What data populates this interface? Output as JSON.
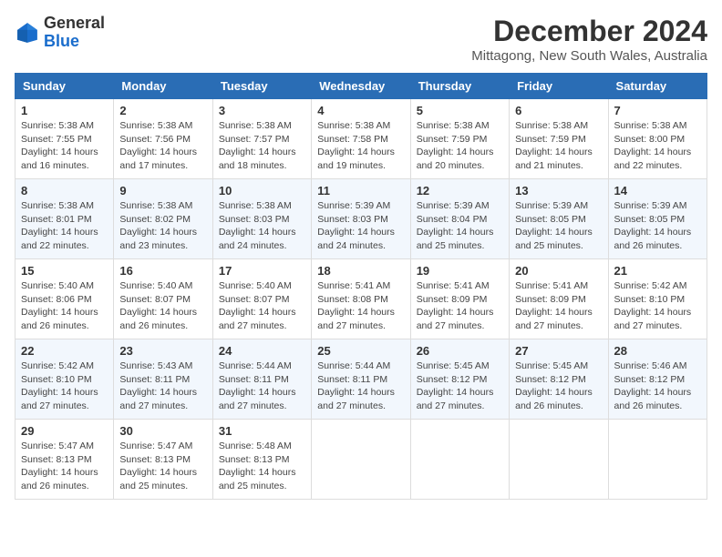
{
  "logo": {
    "general": "General",
    "blue": "Blue"
  },
  "header": {
    "month_title": "December 2024",
    "location": "Mittagong, New South Wales, Australia"
  },
  "days_of_week": [
    "Sunday",
    "Monday",
    "Tuesday",
    "Wednesday",
    "Thursday",
    "Friday",
    "Saturday"
  ],
  "weeks": [
    [
      {
        "day": "1",
        "sunrise": "5:38 AM",
        "sunset": "7:55 PM",
        "daylight": "14 hours and 16 minutes."
      },
      {
        "day": "2",
        "sunrise": "5:38 AM",
        "sunset": "7:56 PM",
        "daylight": "14 hours and 17 minutes."
      },
      {
        "day": "3",
        "sunrise": "5:38 AM",
        "sunset": "7:57 PM",
        "daylight": "14 hours and 18 minutes."
      },
      {
        "day": "4",
        "sunrise": "5:38 AM",
        "sunset": "7:58 PM",
        "daylight": "14 hours and 19 minutes."
      },
      {
        "day": "5",
        "sunrise": "5:38 AM",
        "sunset": "7:59 PM",
        "daylight": "14 hours and 20 minutes."
      },
      {
        "day": "6",
        "sunrise": "5:38 AM",
        "sunset": "7:59 PM",
        "daylight": "14 hours and 21 minutes."
      },
      {
        "day": "7",
        "sunrise": "5:38 AM",
        "sunset": "8:00 PM",
        "daylight": "14 hours and 22 minutes."
      }
    ],
    [
      {
        "day": "8",
        "sunrise": "5:38 AM",
        "sunset": "8:01 PM",
        "daylight": "14 hours and 22 minutes."
      },
      {
        "day": "9",
        "sunrise": "5:38 AM",
        "sunset": "8:02 PM",
        "daylight": "14 hours and 23 minutes."
      },
      {
        "day": "10",
        "sunrise": "5:38 AM",
        "sunset": "8:03 PM",
        "daylight": "14 hours and 24 minutes."
      },
      {
        "day": "11",
        "sunrise": "5:39 AM",
        "sunset": "8:03 PM",
        "daylight": "14 hours and 24 minutes."
      },
      {
        "day": "12",
        "sunrise": "5:39 AM",
        "sunset": "8:04 PM",
        "daylight": "14 hours and 25 minutes."
      },
      {
        "day": "13",
        "sunrise": "5:39 AM",
        "sunset": "8:05 PM",
        "daylight": "14 hours and 25 minutes."
      },
      {
        "day": "14",
        "sunrise": "5:39 AM",
        "sunset": "8:05 PM",
        "daylight": "14 hours and 26 minutes."
      }
    ],
    [
      {
        "day": "15",
        "sunrise": "5:40 AM",
        "sunset": "8:06 PM",
        "daylight": "14 hours and 26 minutes."
      },
      {
        "day": "16",
        "sunrise": "5:40 AM",
        "sunset": "8:07 PM",
        "daylight": "14 hours and 26 minutes."
      },
      {
        "day": "17",
        "sunrise": "5:40 AM",
        "sunset": "8:07 PM",
        "daylight": "14 hours and 27 minutes."
      },
      {
        "day": "18",
        "sunrise": "5:41 AM",
        "sunset": "8:08 PM",
        "daylight": "14 hours and 27 minutes."
      },
      {
        "day": "19",
        "sunrise": "5:41 AM",
        "sunset": "8:09 PM",
        "daylight": "14 hours and 27 minutes."
      },
      {
        "day": "20",
        "sunrise": "5:41 AM",
        "sunset": "8:09 PM",
        "daylight": "14 hours and 27 minutes."
      },
      {
        "day": "21",
        "sunrise": "5:42 AM",
        "sunset": "8:10 PM",
        "daylight": "14 hours and 27 minutes."
      }
    ],
    [
      {
        "day": "22",
        "sunrise": "5:42 AM",
        "sunset": "8:10 PM",
        "daylight": "14 hours and 27 minutes."
      },
      {
        "day": "23",
        "sunrise": "5:43 AM",
        "sunset": "8:11 PM",
        "daylight": "14 hours and 27 minutes."
      },
      {
        "day": "24",
        "sunrise": "5:44 AM",
        "sunset": "8:11 PM",
        "daylight": "14 hours and 27 minutes."
      },
      {
        "day": "25",
        "sunrise": "5:44 AM",
        "sunset": "8:11 PM",
        "daylight": "14 hours and 27 minutes."
      },
      {
        "day": "26",
        "sunrise": "5:45 AM",
        "sunset": "8:12 PM",
        "daylight": "14 hours and 27 minutes."
      },
      {
        "day": "27",
        "sunrise": "5:45 AM",
        "sunset": "8:12 PM",
        "daylight": "14 hours and 26 minutes."
      },
      {
        "day": "28",
        "sunrise": "5:46 AM",
        "sunset": "8:12 PM",
        "daylight": "14 hours and 26 minutes."
      }
    ],
    [
      {
        "day": "29",
        "sunrise": "5:47 AM",
        "sunset": "8:13 PM",
        "daylight": "14 hours and 26 minutes."
      },
      {
        "day": "30",
        "sunrise": "5:47 AM",
        "sunset": "8:13 PM",
        "daylight": "14 hours and 25 minutes."
      },
      {
        "day": "31",
        "sunrise": "5:48 AM",
        "sunset": "8:13 PM",
        "daylight": "14 hours and 25 minutes."
      },
      null,
      null,
      null,
      null
    ]
  ]
}
